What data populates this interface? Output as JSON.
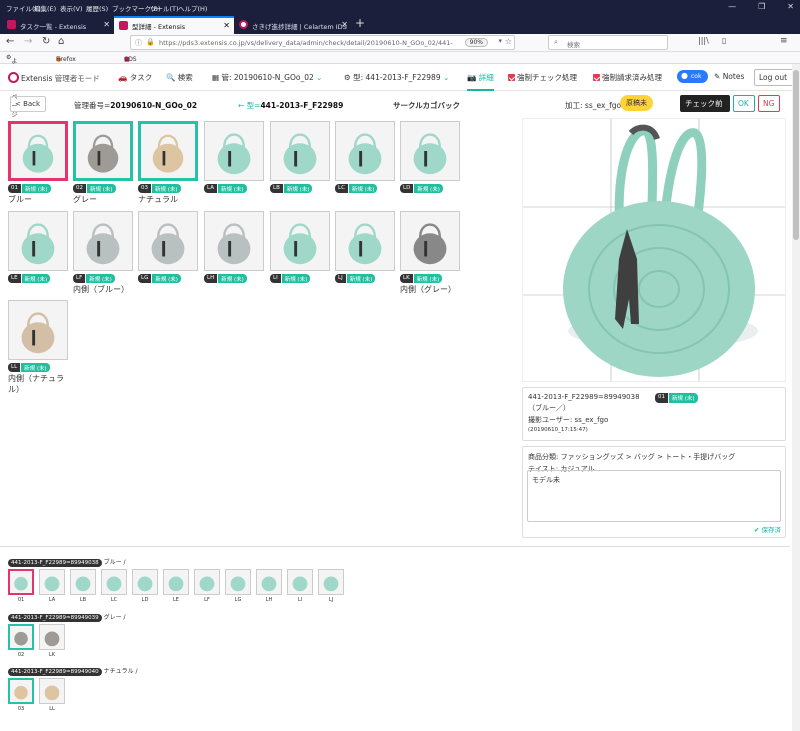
{
  "browser": {
    "menu": [
      "ファイル(F)",
      "編集(E)",
      "表示(V)",
      "履歴(S)",
      "ブックマーク(B)",
      "ツール(T)",
      "ヘルプ(H)"
    ],
    "tabs": [
      {
        "label": "タスク一覧 - Extensis",
        "color": "#c2185b"
      },
      {
        "label": "型詳細 - Extensis",
        "color": "#c2185b"
      },
      {
        "label": "さきげ進捗詳細 | Celartem IDS",
        "color": "#c2185b"
      }
    ],
    "url": "https://pds3.extensis.co.jp/vs/delivery_data/admin/check/detail/20190610-N_GOo_02/441-",
    "zoom": "90%",
    "search_placeholder": "検索",
    "bookmarks": [
      "よく見るページ",
      "Firefox を使いこなそう",
      "CDS 管理"
    ]
  },
  "app": {
    "logo": "Extensis",
    "mode": "管理者モード",
    "nav": {
      "task": "タスク",
      "search": "検索",
      "delivery": "管: 20190610-N_GOo_02",
      "model": "型: 441-2013-F_F22989",
      "detail": "詳細",
      "forced_check": "強制チェック処理",
      "forced_billed": "強制請求済み処理",
      "user": "cok",
      "notes": "Notes",
      "logout": "Log out"
    }
  },
  "subheader": {
    "back": "< Back",
    "mgmt_label": "管理番号=",
    "mgmt_value": "20190610-N_GOo_02",
    "model_label": "← 型=",
    "model_value": "441-2013-F_F22989",
    "product": "サークルカゴバック",
    "process": "加工: ss_ex_fgo",
    "pending": "原稿未",
    "pre_check": "チェック前",
    "ok": "OK",
    "ng": "NG"
  },
  "cells": [
    {
      "code": "01",
      "status": "新規 (未)",
      "label": "ブルー",
      "color": "#9fd8c8"
    },
    {
      "code": "02",
      "status": "新規 (未)",
      "label": "グレー",
      "color": "#9e9a96"
    },
    {
      "code": "03",
      "status": "新規 (未)",
      "label": "ナチュラル",
      "color": "#dcc5a0"
    },
    {
      "code": "LA",
      "status": "新規 (未)",
      "label": "",
      "color": "#9fd8c8"
    },
    {
      "code": "LB",
      "status": "新規 (未)",
      "label": "",
      "color": "#9fd8c8"
    },
    {
      "code": "LC",
      "status": "新規 (未)",
      "label": "",
      "color": "#9fd8c8"
    },
    {
      "code": "LD",
      "status": "新規 (未)",
      "label": "",
      "color": "#9fd8c8"
    },
    {
      "code": "LE",
      "status": "新規 (未)",
      "label": "",
      "color": "#9fd8c8"
    },
    {
      "code": "LF",
      "status": "新規 (未)",
      "label": "内側（ブルー）",
      "color": "#b8c0c0"
    },
    {
      "code": "LG",
      "status": "新規 (未)",
      "label": "",
      "color": "#b8c0c0"
    },
    {
      "code": "LH",
      "status": "新規 (未)",
      "label": "",
      "color": "#b8c0c0"
    },
    {
      "code": "LI",
      "status": "新規 (未)",
      "label": "",
      "color": "#9fd8c8"
    },
    {
      "code": "LJ",
      "status": "新規 (未)",
      "label": "",
      "color": "#9fd8c8"
    },
    {
      "code": "LK",
      "status": "新規 (未)",
      "label": "内側（グレー）",
      "color": "#888"
    },
    {
      "code": "LL",
      "status": "新規 (未)",
      "label": "内側（ナチュラル）",
      "color": "#d2bfa5"
    }
  ],
  "info": {
    "title": "441-2013-F_F22989=89949038",
    "color_name": "（ブルー／）",
    "photographer": "撮影ユーザー: ss_ex_fgo",
    "date": "(20190610_17:15:47)",
    "code": "01",
    "status": "新規 (未)"
  },
  "category": {
    "line1": "商品分類: ファッショングッズ > バッグ > トート・手提げバッグ",
    "line2": "テイスト: カジュアル",
    "memo": "モデル未",
    "saved": "✔ 保存済"
  },
  "groups": [
    {
      "badge": "441-2013-F_F22989=89949038",
      "suffix": "ブルー /",
      "items": [
        "01",
        "LA",
        "LB",
        "LC",
        "LD",
        "LE",
        "LF",
        "LG",
        "LH",
        "LI",
        "LJ"
      ]
    },
    {
      "badge": "441-2013-F_F22989=89949039",
      "suffix": "グレー /",
      "items": [
        "02",
        "LK"
      ]
    },
    {
      "badge": "441-2013-F_F22989=89949040",
      "suffix": "ナチュラル /",
      "items": [
        "03",
        "LL"
      ]
    }
  ]
}
